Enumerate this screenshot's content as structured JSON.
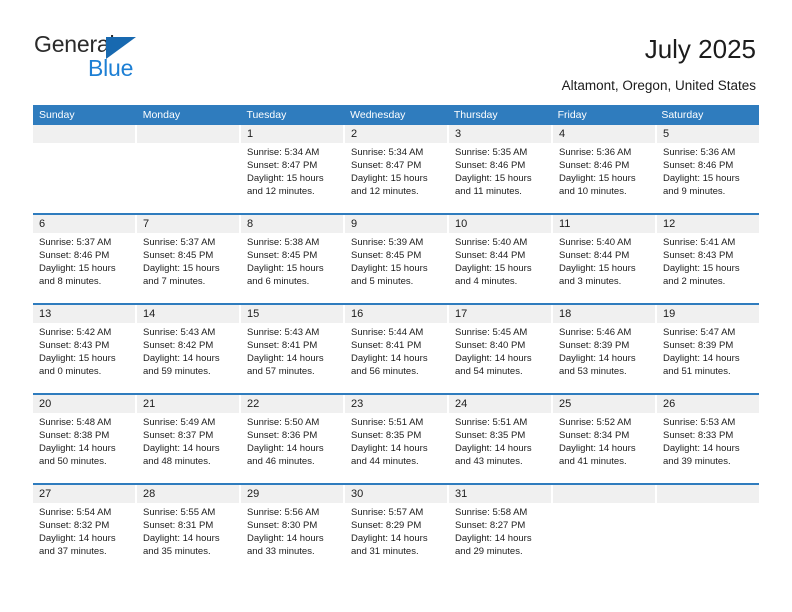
{
  "brand": {
    "name_primary": "General",
    "name_secondary": "Blue",
    "triangle_color": "#1869b0",
    "secondary_color": "#1d7fd4"
  },
  "header": {
    "title": "July 2025",
    "location": "Altamont, Oregon, United States"
  },
  "theme": {
    "header_blue": "#2f7cbe",
    "number_band": "#f0f0f0",
    "text": "#1c1c1c"
  },
  "weekday_headers": [
    "Sunday",
    "Monday",
    "Tuesday",
    "Wednesday",
    "Thursday",
    "Friday",
    "Saturday"
  ],
  "weeks": [
    {
      "numbers": [
        "",
        "",
        "1",
        "2",
        "3",
        "4",
        "5"
      ],
      "cells": [
        {
          "lines": []
        },
        {
          "lines": []
        },
        {
          "lines": [
            "Sunrise: 5:34 AM",
            "Sunset: 8:47 PM",
            "Daylight: 15 hours",
            "and 12 minutes."
          ]
        },
        {
          "lines": [
            "Sunrise: 5:34 AM",
            "Sunset: 8:47 PM",
            "Daylight: 15 hours",
            "and 12 minutes."
          ]
        },
        {
          "lines": [
            "Sunrise: 5:35 AM",
            "Sunset: 8:46 PM",
            "Daylight: 15 hours",
            "and 11 minutes."
          ]
        },
        {
          "lines": [
            "Sunrise: 5:36 AM",
            "Sunset: 8:46 PM",
            "Daylight: 15 hours",
            "and 10 minutes."
          ]
        },
        {
          "lines": [
            "Sunrise: 5:36 AM",
            "Sunset: 8:46 PM",
            "Daylight: 15 hours",
            "and 9 minutes."
          ]
        }
      ]
    },
    {
      "numbers": [
        "6",
        "7",
        "8",
        "9",
        "10",
        "11",
        "12"
      ],
      "cells": [
        {
          "lines": [
            "Sunrise: 5:37 AM",
            "Sunset: 8:46 PM",
            "Daylight: 15 hours",
            "and 8 minutes."
          ]
        },
        {
          "lines": [
            "Sunrise: 5:37 AM",
            "Sunset: 8:45 PM",
            "Daylight: 15 hours",
            "and 7 minutes."
          ]
        },
        {
          "lines": [
            "Sunrise: 5:38 AM",
            "Sunset: 8:45 PM",
            "Daylight: 15 hours",
            "and 6 minutes."
          ]
        },
        {
          "lines": [
            "Sunrise: 5:39 AM",
            "Sunset: 8:45 PM",
            "Daylight: 15 hours",
            "and 5 minutes."
          ]
        },
        {
          "lines": [
            "Sunrise: 5:40 AM",
            "Sunset: 8:44 PM",
            "Daylight: 15 hours",
            "and 4 minutes."
          ]
        },
        {
          "lines": [
            "Sunrise: 5:40 AM",
            "Sunset: 8:44 PM",
            "Daylight: 15 hours",
            "and 3 minutes."
          ]
        },
        {
          "lines": [
            "Sunrise: 5:41 AM",
            "Sunset: 8:43 PM",
            "Daylight: 15 hours",
            "and 2 minutes."
          ]
        }
      ]
    },
    {
      "numbers": [
        "13",
        "14",
        "15",
        "16",
        "17",
        "18",
        "19"
      ],
      "cells": [
        {
          "lines": [
            "Sunrise: 5:42 AM",
            "Sunset: 8:43 PM",
            "Daylight: 15 hours",
            "and 0 minutes."
          ]
        },
        {
          "lines": [
            "Sunrise: 5:43 AM",
            "Sunset: 8:42 PM",
            "Daylight: 14 hours",
            "and 59 minutes."
          ]
        },
        {
          "lines": [
            "Sunrise: 5:43 AM",
            "Sunset: 8:41 PM",
            "Daylight: 14 hours",
            "and 57 minutes."
          ]
        },
        {
          "lines": [
            "Sunrise: 5:44 AM",
            "Sunset: 8:41 PM",
            "Daylight: 14 hours",
            "and 56 minutes."
          ]
        },
        {
          "lines": [
            "Sunrise: 5:45 AM",
            "Sunset: 8:40 PM",
            "Daylight: 14 hours",
            "and 54 minutes."
          ]
        },
        {
          "lines": [
            "Sunrise: 5:46 AM",
            "Sunset: 8:39 PM",
            "Daylight: 14 hours",
            "and 53 minutes."
          ]
        },
        {
          "lines": [
            "Sunrise: 5:47 AM",
            "Sunset: 8:39 PM",
            "Daylight: 14 hours",
            "and 51 minutes."
          ]
        }
      ]
    },
    {
      "numbers": [
        "20",
        "21",
        "22",
        "23",
        "24",
        "25",
        "26"
      ],
      "cells": [
        {
          "lines": [
            "Sunrise: 5:48 AM",
            "Sunset: 8:38 PM",
            "Daylight: 14 hours",
            "and 50 minutes."
          ]
        },
        {
          "lines": [
            "Sunrise: 5:49 AM",
            "Sunset: 8:37 PM",
            "Daylight: 14 hours",
            "and 48 minutes."
          ]
        },
        {
          "lines": [
            "Sunrise: 5:50 AM",
            "Sunset: 8:36 PM",
            "Daylight: 14 hours",
            "and 46 minutes."
          ]
        },
        {
          "lines": [
            "Sunrise: 5:51 AM",
            "Sunset: 8:35 PM",
            "Daylight: 14 hours",
            "and 44 minutes."
          ]
        },
        {
          "lines": [
            "Sunrise: 5:51 AM",
            "Sunset: 8:35 PM",
            "Daylight: 14 hours",
            "and 43 minutes."
          ]
        },
        {
          "lines": [
            "Sunrise: 5:52 AM",
            "Sunset: 8:34 PM",
            "Daylight: 14 hours",
            "and 41 minutes."
          ]
        },
        {
          "lines": [
            "Sunrise: 5:53 AM",
            "Sunset: 8:33 PM",
            "Daylight: 14 hours",
            "and 39 minutes."
          ]
        }
      ]
    },
    {
      "numbers": [
        "27",
        "28",
        "29",
        "30",
        "31",
        "",
        ""
      ],
      "cells": [
        {
          "lines": [
            "Sunrise: 5:54 AM",
            "Sunset: 8:32 PM",
            "Daylight: 14 hours",
            "and 37 minutes."
          ]
        },
        {
          "lines": [
            "Sunrise: 5:55 AM",
            "Sunset: 8:31 PM",
            "Daylight: 14 hours",
            "and 35 minutes."
          ]
        },
        {
          "lines": [
            "Sunrise: 5:56 AM",
            "Sunset: 8:30 PM",
            "Daylight: 14 hours",
            "and 33 minutes."
          ]
        },
        {
          "lines": [
            "Sunrise: 5:57 AM",
            "Sunset: 8:29 PM",
            "Daylight: 14 hours",
            "and 31 minutes."
          ]
        },
        {
          "lines": [
            "Sunrise: 5:58 AM",
            "Sunset: 8:27 PM",
            "Daylight: 14 hours",
            "and 29 minutes."
          ]
        },
        {
          "lines": []
        },
        {
          "lines": []
        }
      ]
    }
  ]
}
